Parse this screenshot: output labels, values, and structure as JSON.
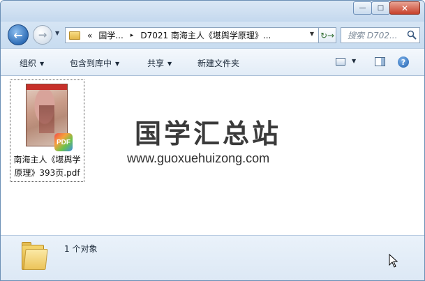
{
  "window": {
    "caption_buttons": {
      "minimize": "—",
      "maximize": "□",
      "close": "✕"
    }
  },
  "address": {
    "chevrons": "«",
    "crumb1": "国学...",
    "sep": "▸",
    "crumb2": "D7021 南海主人《堪舆学原理》...",
    "search_placeholder": "搜索 D702..."
  },
  "toolbar": {
    "organize": "组织",
    "include_library": "包含到库中",
    "share": "共享",
    "new_folder": "新建文件夹"
  },
  "files": [
    {
      "name": "南海主人《堪舆学原理》393页.pdf",
      "badge": "PDF"
    }
  ],
  "watermark": {
    "title": "国学汇总站",
    "url": "www.guoxuehuizong.com"
  },
  "details": {
    "count": "1 个对象"
  },
  "icons": {
    "back": "back-arrow-icon",
    "forward": "forward-arrow-icon",
    "folder": "folder-icon",
    "refresh": "refresh-icon",
    "search": "search-icon",
    "view": "view-options-icon",
    "preview": "preview-pane-icon",
    "help": "help-icon"
  },
  "colors": {
    "accent": "#2f6eb7",
    "chrome": "#cfe0f1"
  }
}
